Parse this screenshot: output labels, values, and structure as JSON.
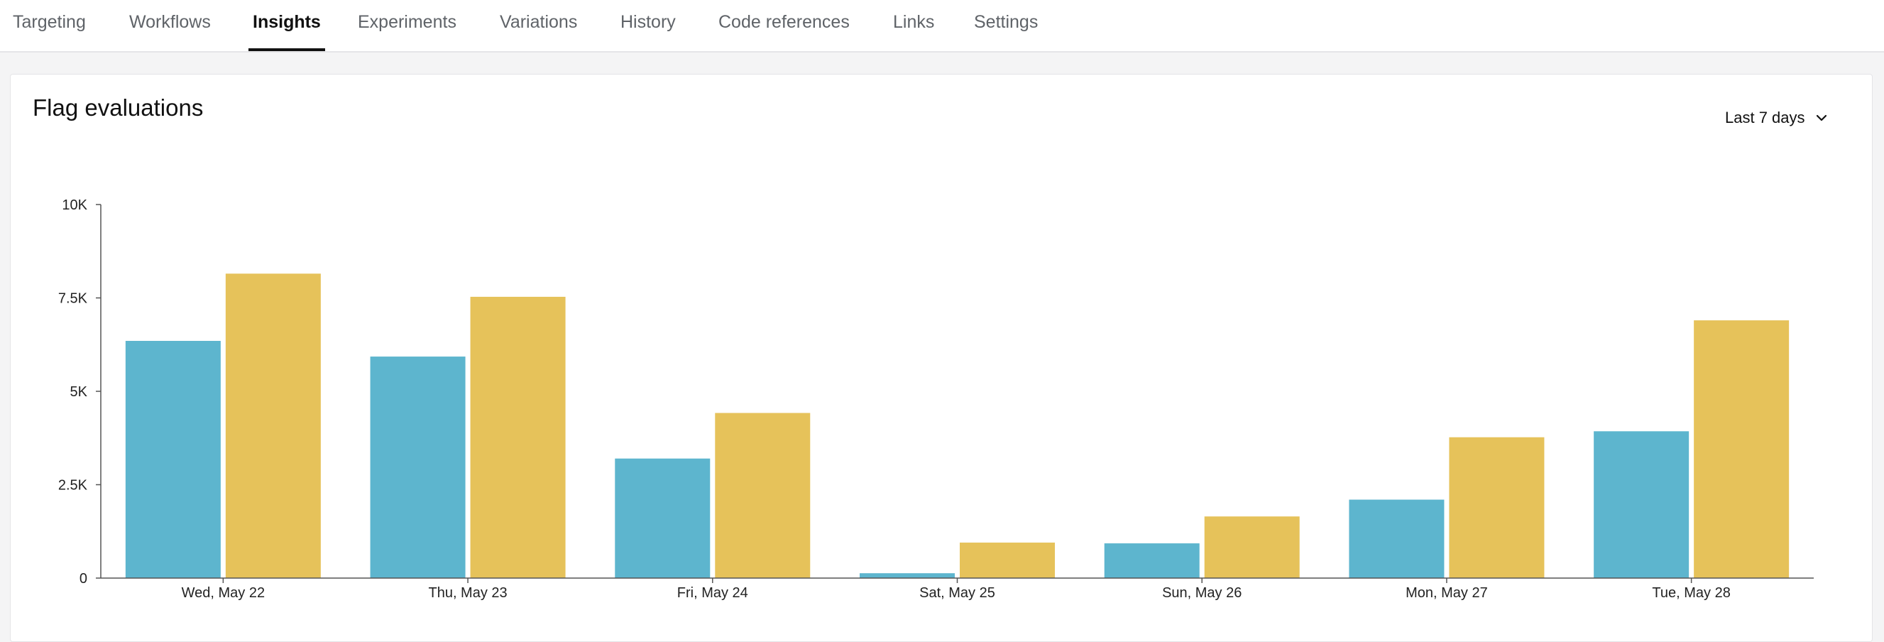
{
  "tabs": [
    {
      "label": "Targeting",
      "active": false
    },
    {
      "label": "Workflows",
      "active": false
    },
    {
      "label": "Insights",
      "active": true
    },
    {
      "label": "Experiments",
      "active": false
    },
    {
      "label": "Variations",
      "active": false
    },
    {
      "label": "History",
      "active": false
    },
    {
      "label": "Code references",
      "active": false
    },
    {
      "label": "Links",
      "active": false
    },
    {
      "label": "Settings",
      "active": false
    }
  ],
  "card": {
    "title": "Flag evaluations",
    "range_label": "Last 7 days",
    "range_icon": "chevron-down-icon"
  },
  "chart_data": {
    "type": "bar",
    "title": "Flag evaluations",
    "xlabel": "",
    "ylabel": "",
    "ylim": [
      0,
      10000
    ],
    "yticks": [
      {
        "value": 0,
        "label": "0"
      },
      {
        "value": 2500,
        "label": "2.5K"
      },
      {
        "value": 5000,
        "label": "5K"
      },
      {
        "value": 7500,
        "label": "7.5K"
      },
      {
        "value": 10000,
        "label": "10K"
      }
    ],
    "categories": [
      "Wed, May 22",
      "Thu, May 23",
      "Fri, May 24",
      "Sat, May 25",
      "Sun, May 26",
      "Mon, May 27",
      "Tue, May 28"
    ],
    "series": [
      {
        "color": "#5db5ce",
        "values": [
          6350,
          5930,
          3200,
          130,
          930,
          2100,
          3930
        ]
      },
      {
        "color": "#e6c25a",
        "values": [
          8150,
          7530,
          4420,
          950,
          1650,
          3770,
          6900
        ]
      }
    ],
    "grid": false,
    "legend": "none"
  }
}
